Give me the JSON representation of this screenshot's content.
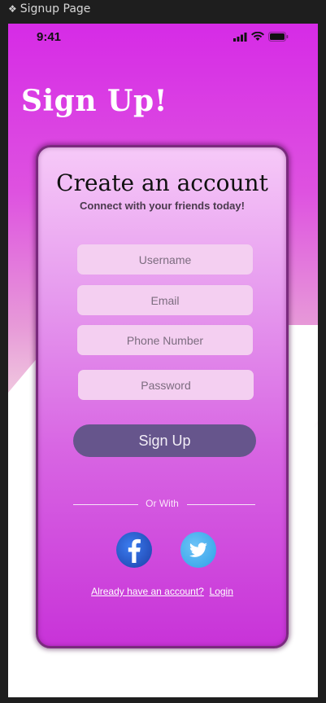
{
  "frame": {
    "label": "Signup Page"
  },
  "status": {
    "time": "9:41"
  },
  "header": {
    "title": "Sign Up!"
  },
  "card": {
    "title": "Create an account",
    "subtitle": "Connect with your friends today!",
    "fields": {
      "username_placeholder": "Username",
      "email_placeholder": "Email",
      "phone_placeholder": "Phone Number",
      "password_placeholder": "Password"
    },
    "signup_label": "Sign Up",
    "divider_text": "Or With",
    "social": [
      "facebook",
      "twitter"
    ],
    "login_prompt": "Already have an account?",
    "login_link": "Login"
  },
  "colors": {
    "accent": "#d62be6",
    "button": "#66558c",
    "field_bg": "#f4cff1",
    "card_border": "#7a2a7e"
  }
}
